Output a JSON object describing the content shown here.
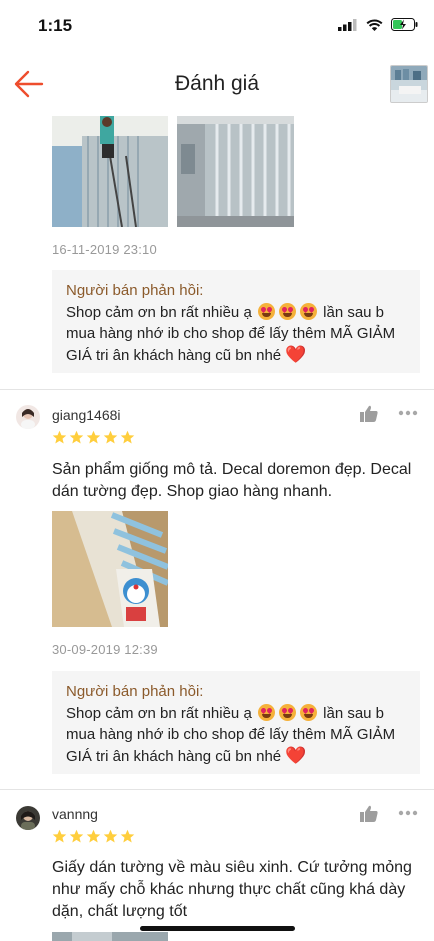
{
  "status_bar": {
    "time": "1:15"
  },
  "header": {
    "title": "Đánh giá"
  },
  "reviews": [
    {
      "date": "16-11-2019 23:10",
      "seller_reply": {
        "label": "Người bán phản hồi:",
        "text_a": "Shop cảm ơn bn rất nhiều ạ",
        "text_b": "lần sau b mua hàng nhớ ib cho shop để lấy thêm MÃ GIẢM GIÁ tri ân khách hàng cũ bn nhé",
        "heart": "❤️"
      }
    },
    {
      "username": "giang1468i",
      "rating": 5,
      "comment": "Sản phẩm giống mô tả. Decal doremon đẹp. Decal dán tường đẹp. Shop giao hàng nhanh.",
      "date": "30-09-2019 12:39",
      "seller_reply": {
        "label": "Người bán phản hồi:",
        "text_a": "Shop cảm ơn bn rất nhiều ạ",
        "text_b": "lần sau b mua hàng nhớ ib cho shop để lấy thêm MÃ GIẢM GIÁ tri ân khách hàng cũ bn nhé",
        "heart": "❤️"
      }
    },
    {
      "username": "vannng",
      "rating": 5,
      "comment": "Giấy dán tường về màu siêu xinh. Cứ tưởng mỏng như mấy chỗ khác nhưng thực chất cũng khá dày dặn, chất lượng tốt"
    }
  ],
  "colors": {
    "accent": "#ee4d2d",
    "star": "#ffce3d",
    "reply_label": "#8b5a2b"
  }
}
